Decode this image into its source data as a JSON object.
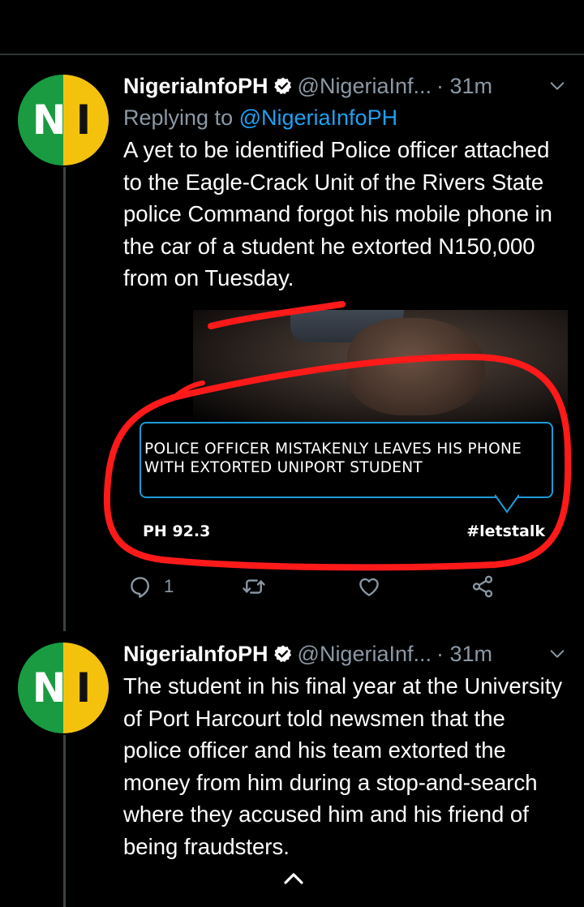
{
  "tweets": [
    {
      "avatar_text_left": "N",
      "avatar_text_right": "I",
      "name": "NigeriaInfoPH",
      "handle": "@NigeriaInf...",
      "time": "· 31m",
      "replying_prefix": "Replying to ",
      "replying_mention": "@NigeriaInfoPH",
      "body": "A yet to be identified Police officer attached to the Eagle-Crack Unit of the Rivers State police Command forgot his mobile phone in the car of a student he extorted N150,000 from on Tuesday.",
      "media": {
        "caption": "POLICE OFFICER MISTAKENLY LEAVES HIS PHONE WITH EXTORTED UNIPORT STUDENT",
        "station": "PH 92.3",
        "hashtag": "#letstalk"
      },
      "actions": {
        "reply_count": "1",
        "retweet_count": "",
        "like_count": ""
      }
    },
    {
      "avatar_text_left": "N",
      "avatar_text_right": "I",
      "name": "NigeriaInfoPH",
      "handle": "@NigeriaInf...",
      "time": "· 31m",
      "body": "The student in his final year at the University of Port Harcourt told newsmen that the police officer and his team extorted the money from him during a stop-and-search where they accused him and his friend of being fraudsters."
    }
  ],
  "icons": {
    "verified": "verified-badge-icon",
    "more": "chevron-down-icon",
    "reply": "reply-icon",
    "retweet": "retweet-icon",
    "like": "heart-icon",
    "share": "share-icon",
    "scroll_up": "chevron-up-icon"
  },
  "colors": {
    "background": "#000000",
    "muted": "#8b98a5",
    "link": "#1da1f2",
    "annotation": "#ff1a1a",
    "avatar_green": "#1a9b41",
    "avatar_yellow": "#f4c20d"
  }
}
